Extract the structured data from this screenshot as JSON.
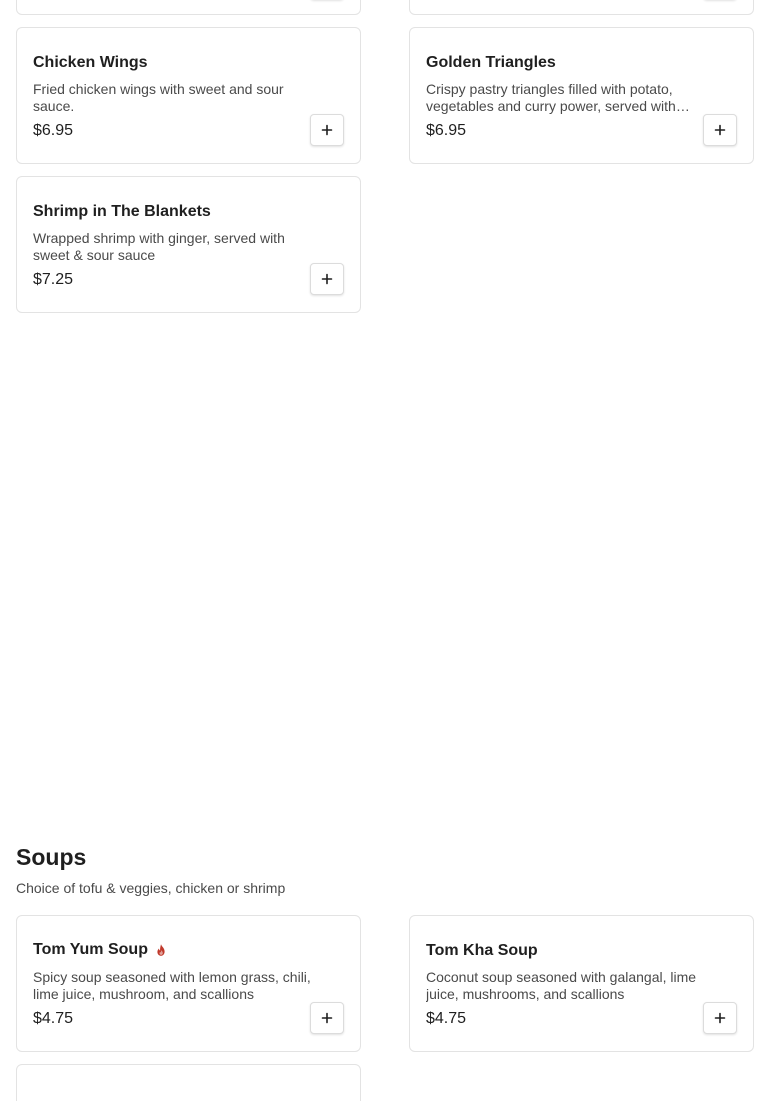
{
  "appetizers": {
    "items": [
      {
        "name": "Chicken Wings",
        "description": "Fried chicken wings with sweet and sour sauce.",
        "price": "$6.95"
      },
      {
        "name": "Golden Triangles",
        "description": "Crispy pastry triangles filled with potato, vegetables and curry power, served with swe...",
        "price": "$6.95"
      },
      {
        "name": "Shrimp in The Blankets",
        "description": "Wrapped shrimp with ginger, served with sweet & sour sauce",
        "price": "$7.25"
      }
    ]
  },
  "soups": {
    "title": "Soups",
    "subtitle": "Choice of tofu & veggies, chicken or shrimp",
    "items": [
      {
        "name": "Tom Yum Soup",
        "spicy": true,
        "description": "Spicy soup seasoned with lemon grass, chili, lime juice, mushroom, and scallions",
        "price": "$4.75"
      },
      {
        "name": "Tom Kha Soup",
        "spicy": false,
        "description": "Coconut soup seasoned with galangal, lime juice, mushrooms, and scallions",
        "price": "$4.75"
      }
    ]
  },
  "icons": {
    "add": "plus-icon",
    "spicy": "flame-icon"
  },
  "colors": {
    "spicy": "#c0392b",
    "border": "#e3e3e3",
    "text": "#1f1f1f",
    "muted": "#4a4a4a"
  }
}
